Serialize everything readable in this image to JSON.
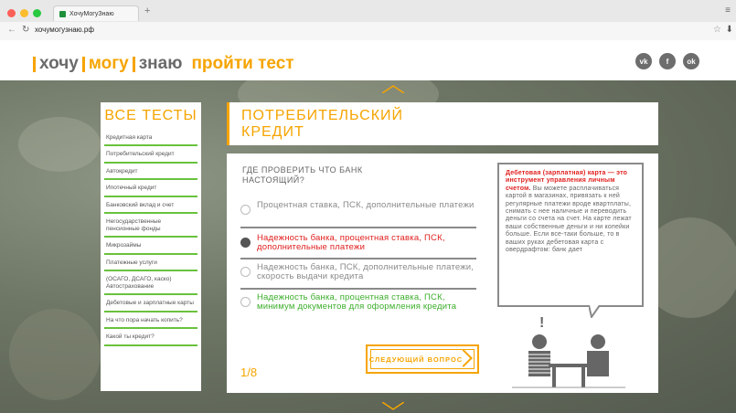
{
  "browser": {
    "tab_title": "ХочуМогуЗнаю",
    "url": "хочумогузнаю.рф"
  },
  "header": {
    "logo_part1": "хочу",
    "logo_part2": "могу",
    "logo_part3": "знаю",
    "cta": "пройти тест",
    "socials": [
      "vk-icon",
      "facebook-icon",
      "odnoklassniki-icon"
    ]
  },
  "sidebar": {
    "title": "ВСЕ ТЕСТЫ",
    "items": [
      {
        "label": "Кредитная карта"
      },
      {
        "label": "Потребительский кредит"
      },
      {
        "label": "Автокредит"
      },
      {
        "label": "Ипотечный кредит"
      },
      {
        "label": "Банковский вклад и счет"
      },
      {
        "label": "Негосударственные пенсионные фонды"
      },
      {
        "label": "Микрозаймы"
      },
      {
        "label": "Платежные услуги"
      },
      {
        "label": "(ОСАГО, ДСАГО, каско) Автострахование"
      },
      {
        "label": "Дебетовые и зарплатные карты"
      },
      {
        "label": "На что пора начать копить?"
      },
      {
        "label": "Какой ты кредит?"
      }
    ]
  },
  "test": {
    "title_line1": "ПОТРЕБИТЕЛЬСКИЙ",
    "title_line2": "КРЕДИТ",
    "question": "ГДЕ ПРОВЕРИТЬ ЧТО БАНК НАСТОЯЩИЙ?",
    "options": [
      {
        "label": "Процентная ставка, ПСК, дополнительные платежи",
        "color": "#8a8a8a",
        "checked": false
      },
      {
        "label": "Надежность банка, процентная ставка, ПСК, дополнительные платежи",
        "color": "#e0201f",
        "checked": true
      },
      {
        "label": "Надежность банка, ПСК, дополнительные платежи, скорость выдачи кредита",
        "color": "#8a8a8a",
        "checked": false
      },
      {
        "label": "Надежность банка, процентная ставка, ПСК, минимум документов для оформления кредита",
        "color": "#3cae2b",
        "checked": false
      }
    ],
    "counter": "1/8",
    "next_button": "СЛЕДУЮЩИЙ ВОПРОС",
    "info_red": "Дебетовая (зарплатная) карта — это инструмент управления личным счетом.",
    "info_text": "Вы можете расплачиваться картой в магазинах, привязать к ней регулярные платежи вроде квартплаты, снимать с нее наличные и переводить деньги со счета на счет. На карте лежат ваши собственные деньги и ни копейки больше. Если все-таки больше, то в ваших руках дебетовая карта с овердрафтом: банк дает",
    "exclamation": "!"
  },
  "colors": {
    "accent": "#f6a400",
    "green": "#69c23d",
    "red": "#e0201f"
  }
}
